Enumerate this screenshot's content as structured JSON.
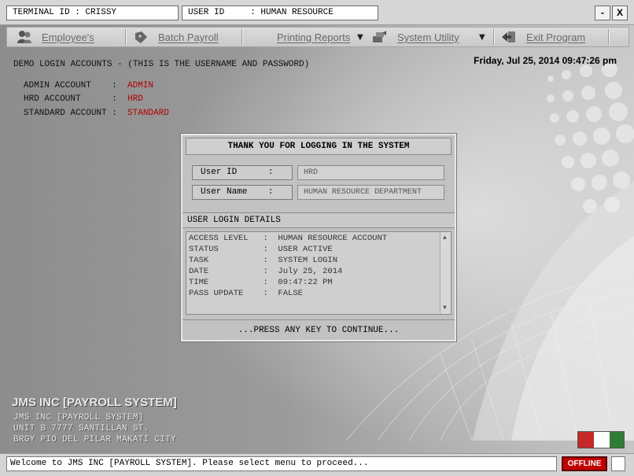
{
  "header": {
    "terminal": "TERMINAL ID : CRISSY",
    "user": "USER ID     : HUMAN RESOURCE",
    "minimize": "-",
    "close": "X"
  },
  "menu": {
    "employees": "Employee's",
    "batch_payroll": "Batch Payroll",
    "printing_reports": "Printing Reports",
    "system_utility": "System Utility",
    "exit_program": "Exit Program"
  },
  "datetime": "Friday, Jul 25, 2014  09:47:26 pm",
  "demo": {
    "title": "DEMO LOGIN ACCOUNTS - (THIS IS THE USERNAME AND PASSWORD)",
    "accounts": [
      {
        "label": "ADMIN ACCOUNT    :  ",
        "value": "ADMIN"
      },
      {
        "label": "HRD ACCOUNT      :  ",
        "value": "HRD"
      },
      {
        "label": "STANDARD ACCOUNT :  ",
        "value": "STANDARD"
      }
    ]
  },
  "dialog": {
    "title": "THANK YOU FOR LOGGING IN THE SYSTEM",
    "userid_label": "User ID      :",
    "userid_value": "HRD",
    "username_label": "User Name    :",
    "username_value": "HUMAN RESOURCE DEPARTMENT",
    "details_title": "USER LOGIN DETAILS",
    "details": [
      "ACCESS LEVEL   :  HUMAN RESOURCE ACCOUNT",
      "STATUS         :  USER ACTIVE",
      "TASK           :  SYSTEM LOGIN",
      "DATE           :  July 25, 2014",
      "TIME           :  09:47:22 PM",
      "PASS UPDATE    :  FALSE"
    ],
    "continue": "...PRESS ANY KEY TO CONTINUE..."
  },
  "company": {
    "title": "JMS INC [PAYROLL SYSTEM]",
    "line1": "JMS INC [PAYROLL SYSTEM]",
    "line2": "UNIT B 7777 SANTILLAN ST.",
    "line3": "BRGY PIO DEL PILAR MAKATI CITY",
    "logo": "JMS Inc."
  },
  "status": {
    "message": "Welcome to JMS INC [PAYROLL SYSTEM]. Please select menu to proceed...",
    "connection": "OFFLINE"
  },
  "colors": {
    "accent_red": "#b30000",
    "offline_red": "#c40000",
    "logo_green": "#2e7d32"
  }
}
